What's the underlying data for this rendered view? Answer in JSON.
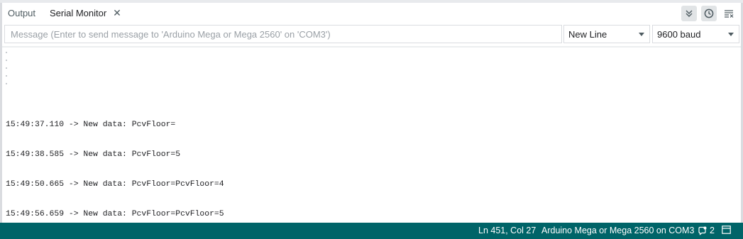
{
  "tabs": {
    "output_label": "Output",
    "serial_label": "Serial Monitor",
    "close_glyph": "✕"
  },
  "toolbar": {
    "autoscroll_icon": "double-chevron-down-icon",
    "timestamp_icon": "clock-icon",
    "clear_icon": "clear-output-icon"
  },
  "input": {
    "placeholder": "Message (Enter to send message to 'Arduino Mega or Mega 2560' on 'COM3')",
    "value": ""
  },
  "line_ending": {
    "selected": "New Line"
  },
  "baud": {
    "selected": "9600 baud"
  },
  "console": {
    "lines": [
      "15:49:37.110 -> New data: PcvFloor=",
      "15:49:38.585 -> New data: PcvFloor=5",
      "15:49:50.665 -> New data: PcvFloor=PcvFloor=4",
      "15:49:56.659 -> New data: PcvFloor=PcvFloor=5"
    ]
  },
  "status": {
    "position": "Ln 451, Col 27",
    "board": "Arduino Mega or Mega 2560 on COM3",
    "notifications_count": "2"
  },
  "colors": {
    "status_bar": "#006468",
    "text": "#202124",
    "muted": "#4e5b61"
  }
}
